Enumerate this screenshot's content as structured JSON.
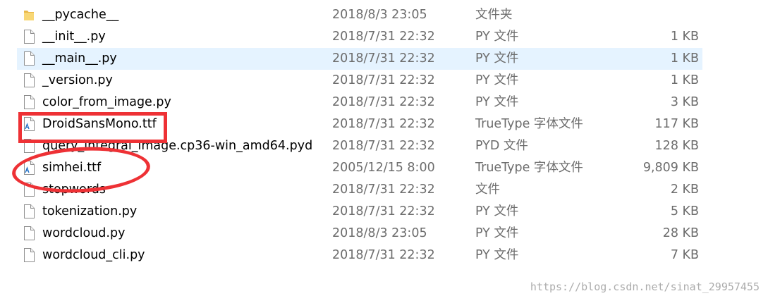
{
  "files": [
    {
      "name": "__pycache__",
      "date": "2018/8/3 23:05",
      "type": "文件夹",
      "size": "",
      "icon": "folder-icon",
      "selected": false
    },
    {
      "name": "__init__.py",
      "date": "2018/7/31 22:32",
      "type": "PY 文件",
      "size": "1 KB",
      "icon": "file-icon",
      "selected": false
    },
    {
      "name": "__main__.py",
      "date": "2018/7/31 22:32",
      "type": "PY 文件",
      "size": "1 KB",
      "icon": "file-icon",
      "selected": true
    },
    {
      "name": "_version.py",
      "date": "2018/7/31 22:32",
      "type": "PY 文件",
      "size": "1 KB",
      "icon": "file-icon",
      "selected": false
    },
    {
      "name": "color_from_image.py",
      "date": "2018/7/31 22:32",
      "type": "PY 文件",
      "size": "3 KB",
      "icon": "file-icon",
      "selected": false
    },
    {
      "name": "DroidSansMono.ttf",
      "date": "2018/7/31 22:32",
      "type": "TrueType 字体文件",
      "size": "117 KB",
      "icon": "font-file-icon",
      "selected": false
    },
    {
      "name": "query_integral_image.cp36-win_amd64.pyd",
      "date": "2018/7/31 22:32",
      "type": "PYD 文件",
      "size": "128 KB",
      "icon": "file-icon",
      "selected": false
    },
    {
      "name": "simhei.ttf",
      "date": "2005/12/15 8:00",
      "type": "TrueType 字体文件",
      "size": "9,809 KB",
      "icon": "font-file-icon",
      "selected": false
    },
    {
      "name": "stopwords",
      "date": "2018/7/31 22:32",
      "type": "文件",
      "size": "2 KB",
      "icon": "file-icon",
      "selected": false
    },
    {
      "name": "tokenization.py",
      "date": "2018/7/31 22:32",
      "type": "PY 文件",
      "size": "5 KB",
      "icon": "file-icon",
      "selected": false
    },
    {
      "name": "wordcloud.py",
      "date": "2018/8/3 23:05",
      "type": "PY 文件",
      "size": "28 KB",
      "icon": "file-icon",
      "selected": false
    },
    {
      "name": "wordcloud_cli.py",
      "date": "2018/7/31 22:32",
      "type": "PY 文件",
      "size": "7 KB",
      "icon": "file-icon",
      "selected": false
    }
  ],
  "annotations": {
    "color": "#ee3135"
  },
  "watermark": "https://blog.csdn.net/sinat_29957455",
  "colors": {
    "selection": "#e5f3ff",
    "folder": "#f8d775",
    "font_accent": "#1f6fc5",
    "secondary_text": "#6d6d6d"
  }
}
